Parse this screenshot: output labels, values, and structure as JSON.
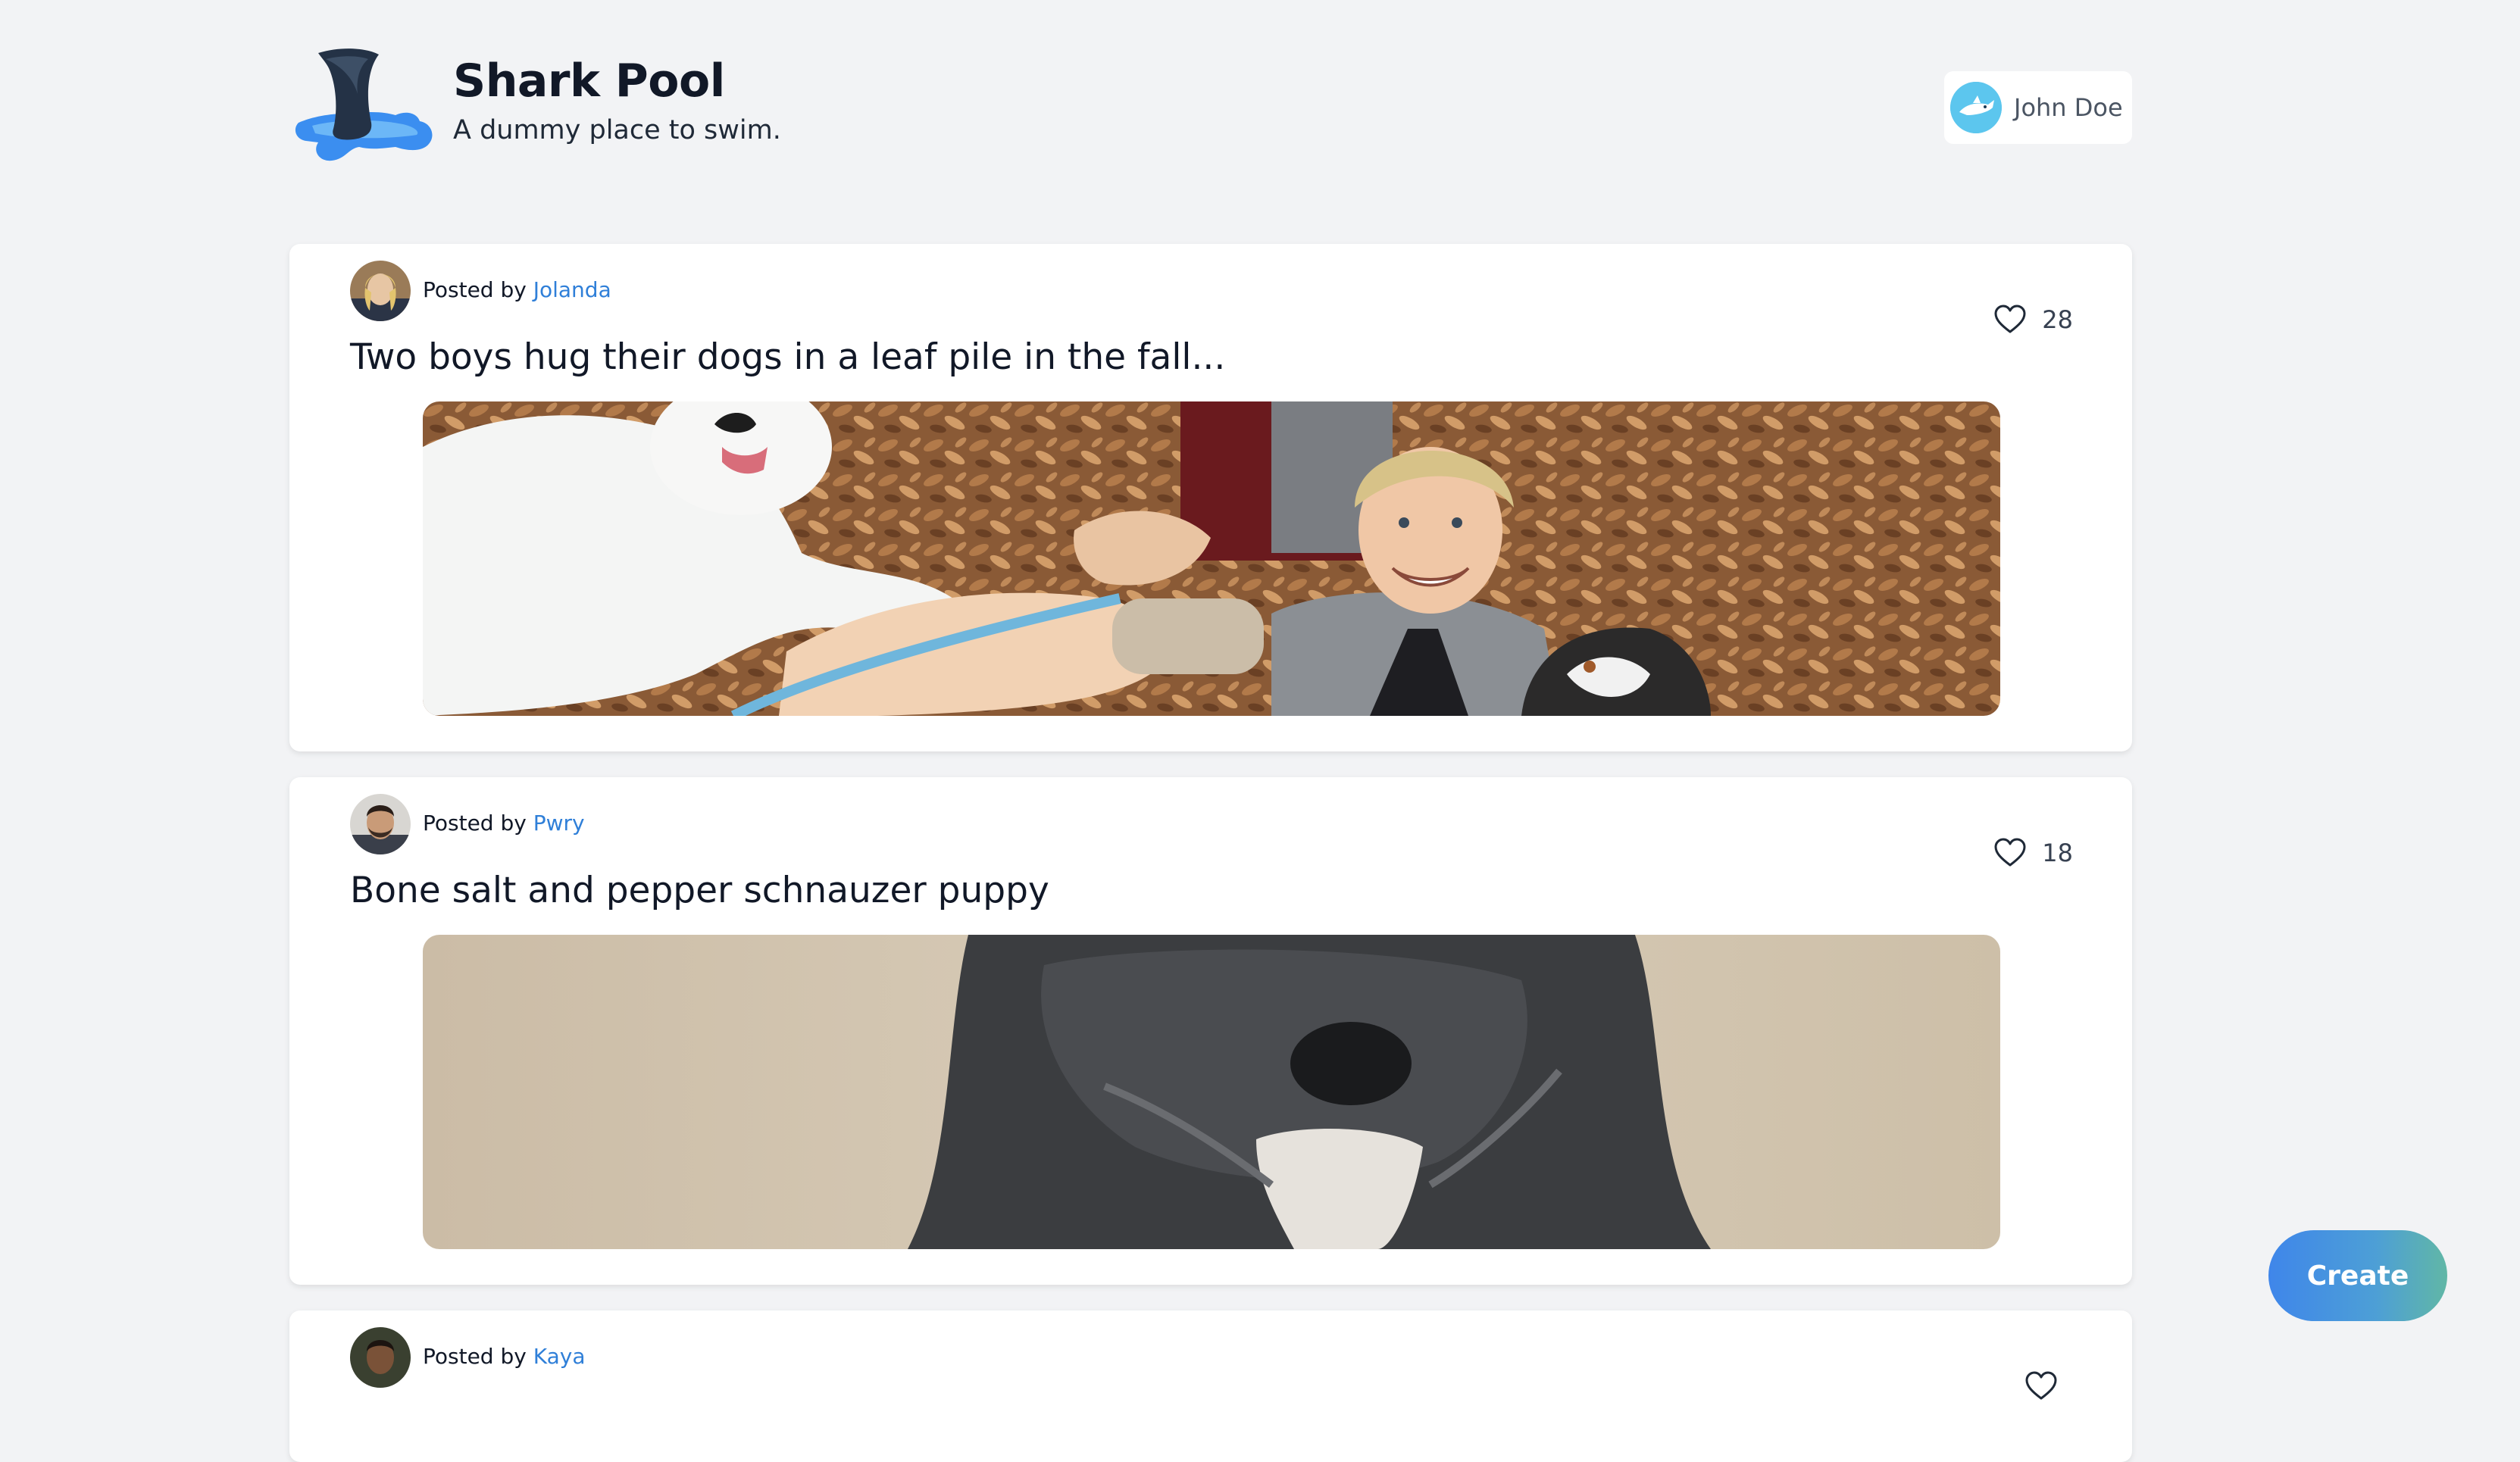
{
  "header": {
    "site_title": "Shark Pool",
    "tagline": "A dummy place to swim.",
    "logo_icon": "shark-fin-logo",
    "user": {
      "name": "John Doe",
      "avatar_icon": "shark-avatar"
    }
  },
  "posts": [
    {
      "posted_by_prefix": "Posted by ",
      "author": "Jolanda",
      "title": "Two boys hug their dogs in a leaf pile in the fall...",
      "likes": "28"
    },
    {
      "posted_by_prefix": "Posted by ",
      "author": "Pwry",
      "title": "Bone salt and pepper schnauzer puppy",
      "likes": "18"
    },
    {
      "posted_by_prefix": "Posted by ",
      "author": "Kaya",
      "title": "",
      "likes": ""
    }
  ],
  "actions": {
    "create_label": "Create"
  },
  "colors": {
    "background": "#f2f3f5",
    "card": "#ffffff",
    "link": "#2f7fd8",
    "create_gradient_start": "#3f86ea",
    "create_gradient_end": "#61b7a6"
  }
}
